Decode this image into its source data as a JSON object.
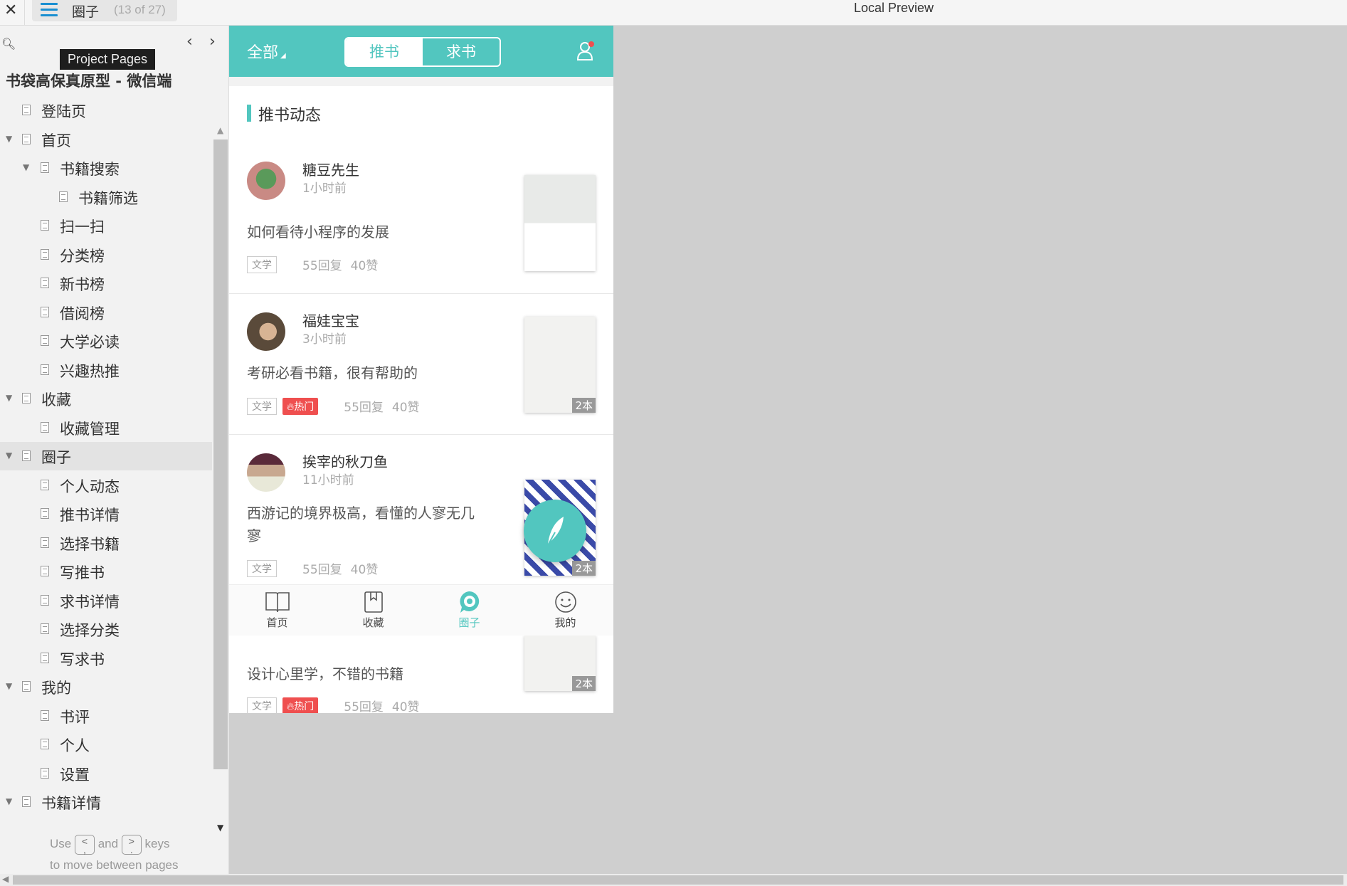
{
  "topbar": {
    "page_name": "圈子",
    "page_count": "(13 of 27)",
    "preview_title": "Local Preview",
    "tooltip": "Project Pages"
  },
  "sidebar": {
    "project_title": "书袋高保真原型 - 微信端",
    "items": [
      {
        "label": "登陆页",
        "level": 0,
        "expanded": null
      },
      {
        "label": "首页",
        "level": 0,
        "expanded": true
      },
      {
        "label": "书籍搜索",
        "level": 1,
        "expanded": true
      },
      {
        "label": "书籍筛选",
        "level": 2,
        "expanded": null
      },
      {
        "label": "扫一扫",
        "level": 1,
        "expanded": null
      },
      {
        "label": "分类榜",
        "level": 1,
        "expanded": null
      },
      {
        "label": "新书榜",
        "level": 1,
        "expanded": null
      },
      {
        "label": "借阅榜",
        "level": 1,
        "expanded": null
      },
      {
        "label": "大学必读",
        "level": 1,
        "expanded": null
      },
      {
        "label": "兴趣热推",
        "level": 1,
        "expanded": null
      },
      {
        "label": "收藏",
        "level": 0,
        "expanded": true
      },
      {
        "label": "收藏管理",
        "level": 1,
        "expanded": null
      },
      {
        "label": "圈子",
        "level": 0,
        "expanded": true,
        "selected": true
      },
      {
        "label": "个人动态",
        "level": 1,
        "expanded": null
      },
      {
        "label": "推书详情",
        "level": 1,
        "expanded": null
      },
      {
        "label": "选择书籍",
        "level": 1,
        "expanded": null
      },
      {
        "label": "写推书",
        "level": 1,
        "expanded": null
      },
      {
        "label": "求书详情",
        "level": 1,
        "expanded": null
      },
      {
        "label": "选择分类",
        "level": 1,
        "expanded": null
      },
      {
        "label": "写求书",
        "level": 1,
        "expanded": null
      },
      {
        "label": "我的",
        "level": 0,
        "expanded": true
      },
      {
        "label": "书评",
        "level": 1,
        "expanded": null
      },
      {
        "label": "个人",
        "level": 1,
        "expanded": null
      },
      {
        "label": "设置",
        "level": 1,
        "expanded": null
      },
      {
        "label": "书籍详情",
        "level": 0,
        "expanded": true
      }
    ],
    "hint": {
      "use": "Use",
      "key_prev_top": "<",
      "key_prev_bottom": ",",
      "and": "and",
      "key_next_top": ">",
      "key_next_bottom": ".",
      "keys": "keys",
      "line2": "to move between pages"
    }
  },
  "app": {
    "accent": "#52c6bf",
    "filter_label": "全部",
    "segments": [
      {
        "label": "推书",
        "active": true
      },
      {
        "label": "求书",
        "active": false
      }
    ],
    "section_title": "推书动态",
    "posts": [
      {
        "user": "糖豆先生",
        "time": "1小时前",
        "text": "如何看待小程序的发展",
        "tag": "文学",
        "hot": null,
        "replies": "55回复",
        "likes": "40赞",
        "book_count": null
      },
      {
        "user": "福娃宝宝",
        "time": "3小时前",
        "text": "考研必看书籍，很有帮助的",
        "tag": "文学",
        "hot": "热门",
        "replies": "55回复",
        "likes": "40赞",
        "book_count": "2本"
      },
      {
        "user": "挨宰的秋刀鱼",
        "time": "11小时前",
        "text": "西游记的境界极高，看懂的人寥无几寥",
        "tag": "文学",
        "hot": null,
        "replies": "55回复",
        "likes": "40赞",
        "book_count": "2本"
      },
      {
        "text": "设计心里学，不错的书籍",
        "tag": "文学",
        "hot": "热门",
        "replies": "55回复",
        "likes": "40赞",
        "book_count": "2本"
      }
    ],
    "tabs": [
      {
        "label": "首页",
        "icon": "book-open-icon"
      },
      {
        "label": "收藏",
        "icon": "bookmark-icon"
      },
      {
        "label": "圈子",
        "icon": "circle-chat-icon",
        "active": true
      },
      {
        "label": "我的",
        "icon": "smiley-icon"
      }
    ]
  }
}
